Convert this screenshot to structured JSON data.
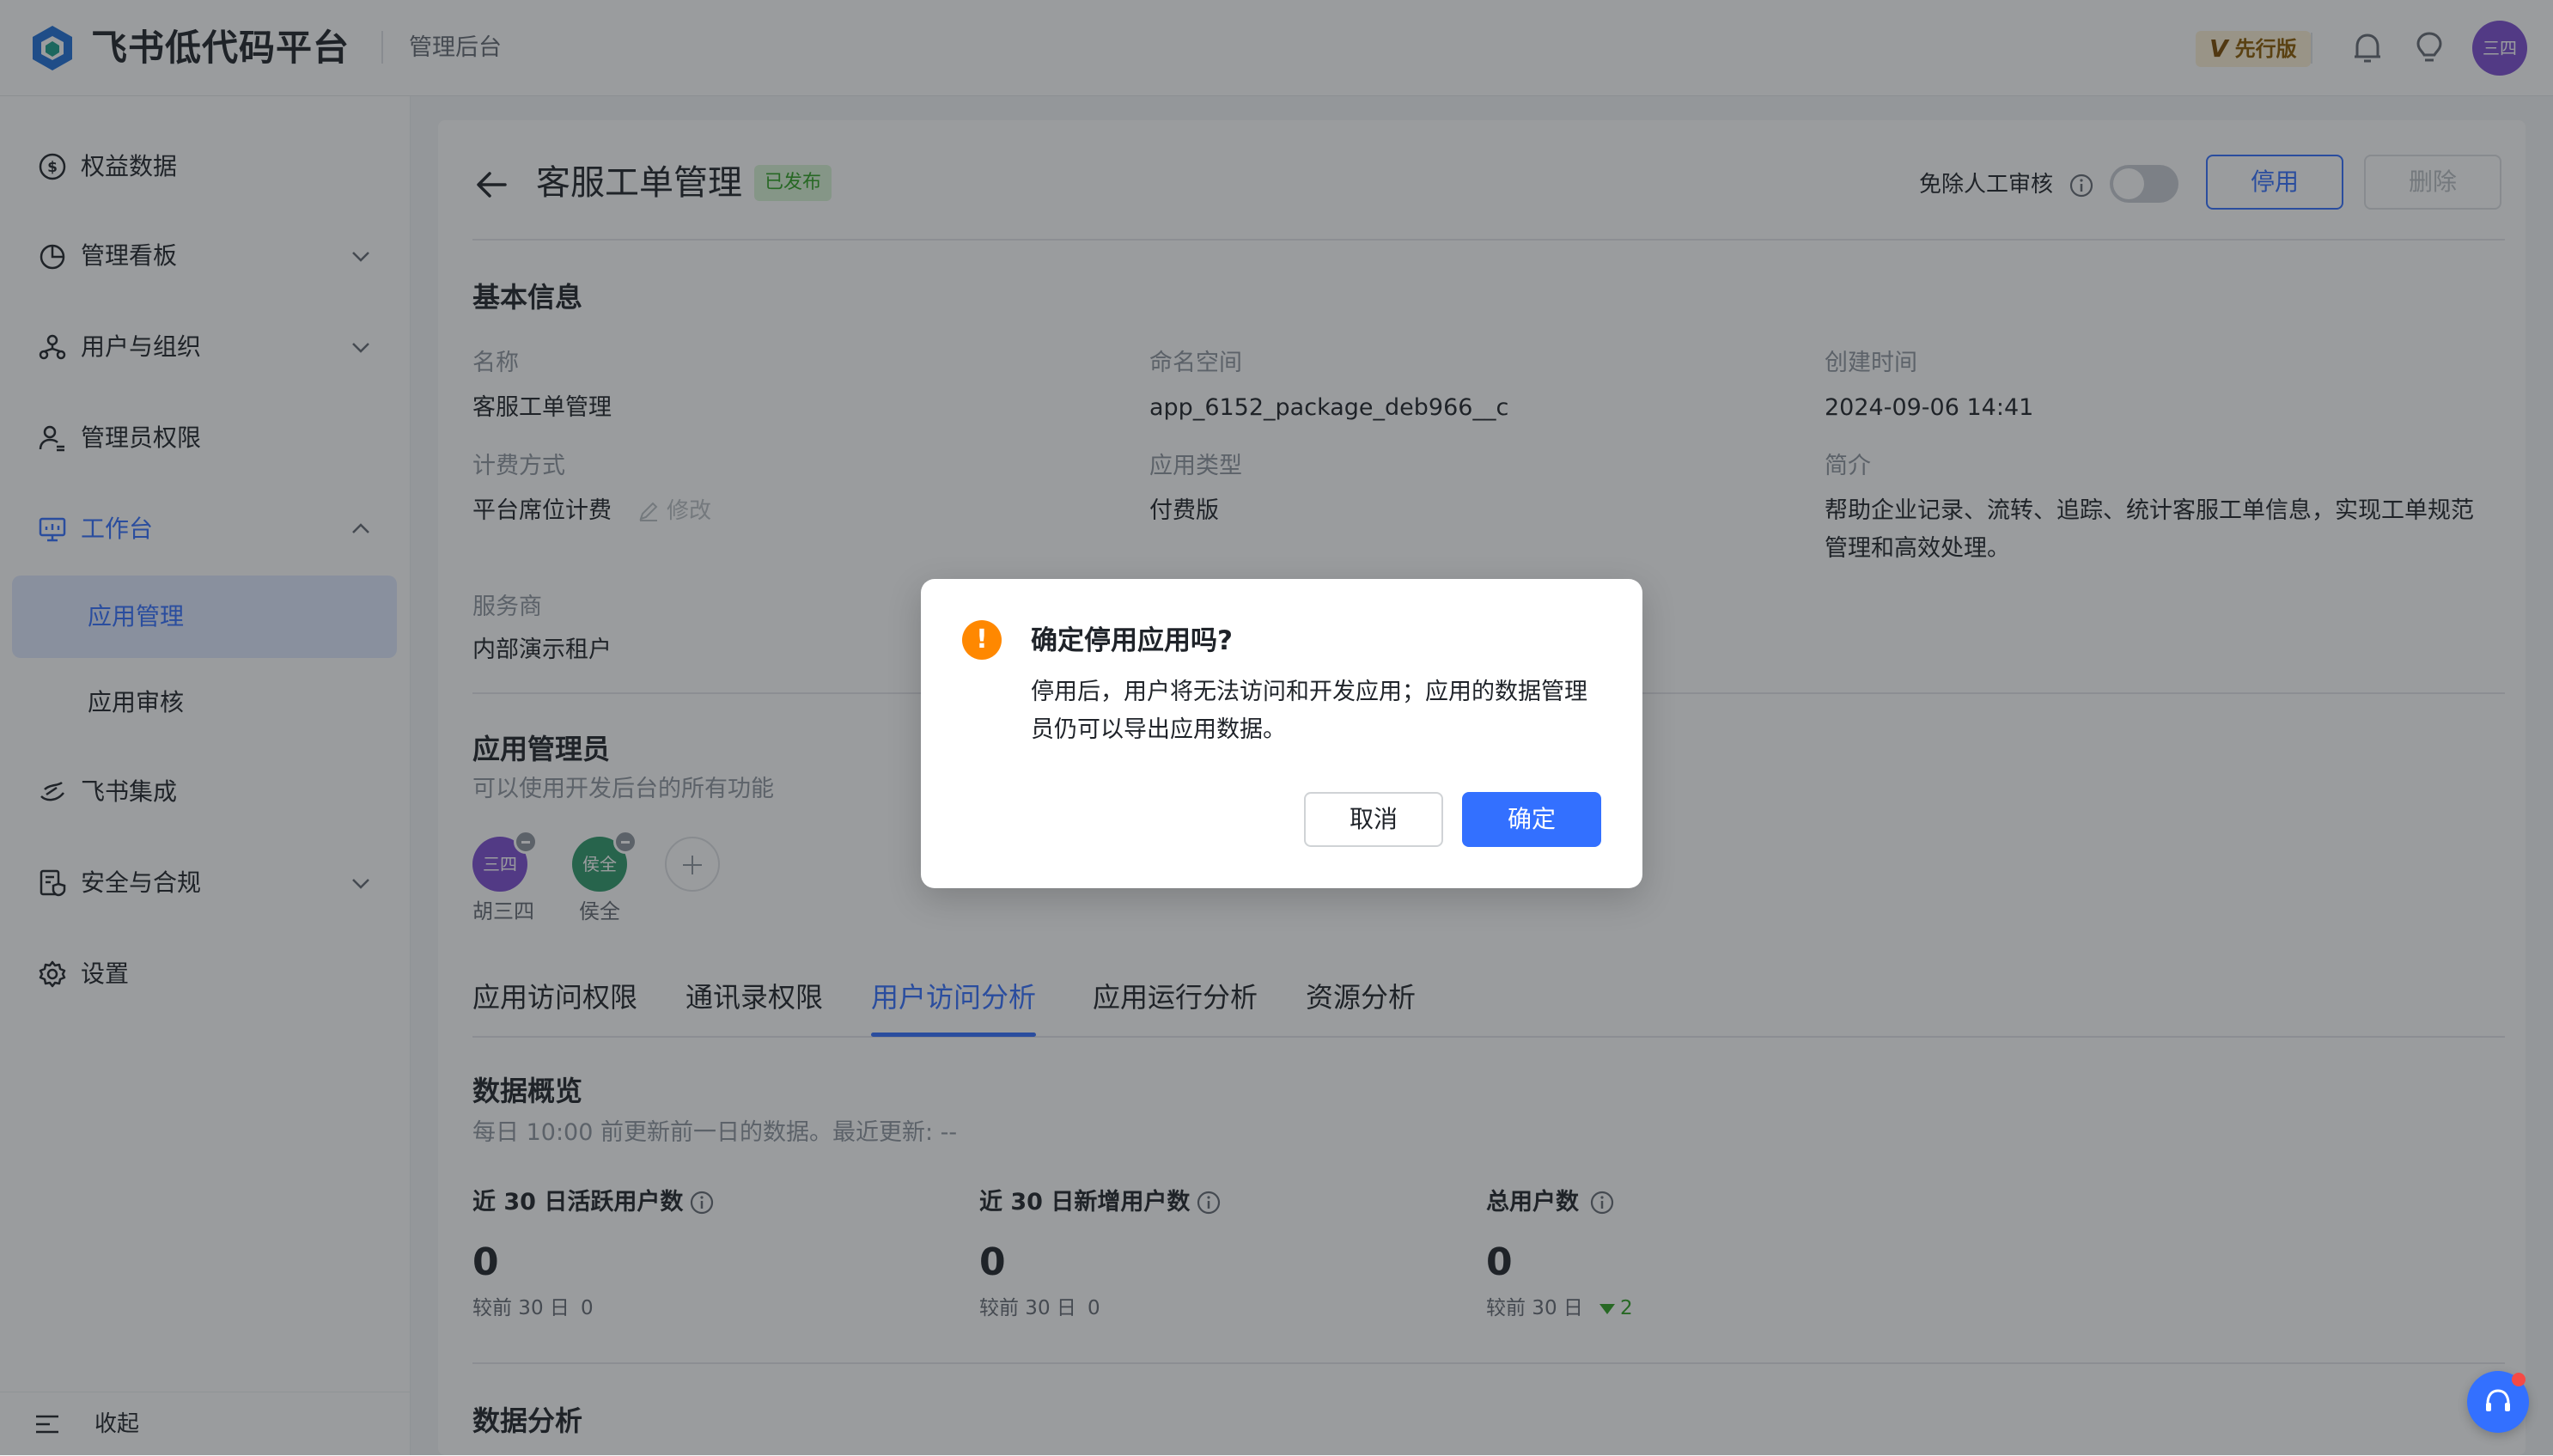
{
  "header": {
    "brand": "飞书低代码平台",
    "subtitle": "管理后台",
    "edition_badge": "先行版",
    "edition_mark": "V",
    "user_avatar": "三四"
  },
  "sidebar": {
    "items": [
      {
        "label": "权益数据",
        "icon": "dollar-icon"
      },
      {
        "label": "管理看板",
        "icon": "pie-chart-icon"
      },
      {
        "label": "用户与组织",
        "icon": "org-icon"
      },
      {
        "label": "管理员权限",
        "icon": "admin-user-icon"
      },
      {
        "label": "工作台",
        "icon": "monitor-icon"
      },
      {
        "label": "飞书集成",
        "icon": "integration-icon"
      },
      {
        "label": "安全与合规",
        "icon": "shield-doc-icon"
      },
      {
        "label": "设置",
        "icon": "gear-icon"
      }
    ],
    "sub_items": [
      {
        "label": "应用管理"
      },
      {
        "label": "应用审核"
      }
    ],
    "collapse_label": "收起"
  },
  "page": {
    "title": "客服工单管理",
    "status": "已发布",
    "manual_review_label": "免除人工审核",
    "disable_button": "停用",
    "delete_button": "删除"
  },
  "basic_info": {
    "section_title": "基本信息",
    "fields": {
      "name_label": "名称",
      "name_value": "客服工单管理",
      "namespace_label": "命名空间",
      "namespace_value": "app_6152_package_deb966__c",
      "created_label": "创建时间",
      "created_value": "2024-09-06 14:41",
      "billing_label": "计费方式",
      "billing_value": "平台席位计费",
      "billing_edit": "修改",
      "type_label": "应用类型",
      "type_value": "付费版",
      "intro_label": "简介",
      "intro_line1": "帮助企业记录、流转、追踪、统计客服工单信息，实现工单规范",
      "intro_line2": "管理和高效处理。",
      "provider_label": "服务商",
      "provider_value": "内部演示租户"
    }
  },
  "admins": {
    "section_title": "应用管理员",
    "description": "可以使用开发后台的所有功能",
    "members": [
      {
        "avatar": "三四",
        "name": "胡三四",
        "color": "#7c4dd1"
      },
      {
        "avatar": "侯全",
        "name": "侯全",
        "color": "#2e9a6a"
      }
    ]
  },
  "tabs": [
    {
      "label": "应用访问权限"
    },
    {
      "label": "通讯录权限"
    },
    {
      "label": "用户访问分析"
    },
    {
      "label": "应用运行分析"
    },
    {
      "label": "资源分析"
    }
  ],
  "overview": {
    "title": "数据概览",
    "update_note": "每日 10:00 前更新前一日的数据。最近更新: --",
    "metrics": [
      {
        "title": "近 30 日活跃用户数",
        "value": "0",
        "compare_label": "较前 30 日",
        "compare_value": "0"
      },
      {
        "title": "近 30 日新增用户数",
        "value": "0",
        "compare_label": "较前 30 日",
        "compare_value": "0"
      },
      {
        "title": "总用户数",
        "value": "0",
        "compare_label": "较前 30 日",
        "compare_value": "2"
      }
    ],
    "analysis_title": "数据分析"
  },
  "modal": {
    "icon": "!",
    "title": "确定停用应用吗?",
    "body": "停用后，用户将无法访问和开发应用；应用的数据管理员仍可以导出应用数据。",
    "cancel": "取消",
    "confirm": "确定"
  },
  "colors": {
    "accent": "#3370ff",
    "warning": "#ff8800",
    "success": "#2ea121"
  }
}
